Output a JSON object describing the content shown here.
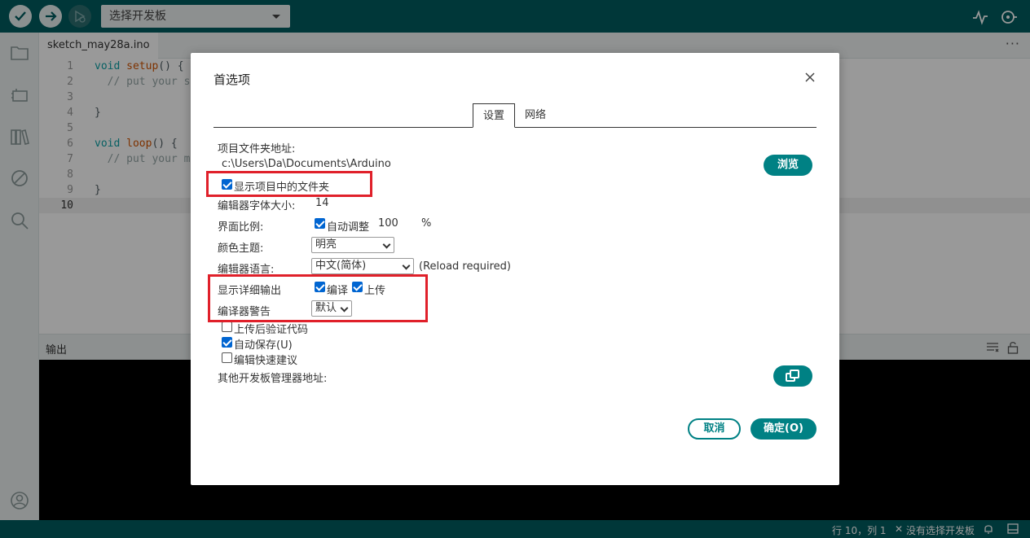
{
  "toolbar": {
    "board_select": "选择开发板",
    "verify_icon": "check-icon",
    "upload_icon": "arrow-right-icon",
    "debug_icon": "debug-icon",
    "serial_plotter_icon": "pulse-icon",
    "serial_monitor_icon": "magnifier-dot-icon"
  },
  "sidebar": {
    "items": [
      "folder-icon",
      "board-icon",
      "library-icon",
      "debug-disabled-icon",
      "search-icon"
    ],
    "account_icon": "user-icon"
  },
  "tabbar": {
    "active_tab": "sketch_may28a.ino",
    "more": "···"
  },
  "editor": {
    "lines": [
      {
        "n": "1",
        "kw": "void",
        "fn": "setup",
        "rest": "() {",
        "comment": ""
      },
      {
        "n": "2",
        "kw": "",
        "fn": "",
        "rest": "  ",
        "comment": "// put your se"
      },
      {
        "n": "3",
        "kw": "",
        "fn": "",
        "rest": "",
        "comment": ""
      },
      {
        "n": "4",
        "kw": "",
        "fn": "",
        "rest": "}",
        "comment": ""
      },
      {
        "n": "5",
        "kw": "",
        "fn": "",
        "rest": "",
        "comment": ""
      },
      {
        "n": "6",
        "kw": "void",
        "fn": "loop",
        "rest": "() {",
        "comment": ""
      },
      {
        "n": "7",
        "kw": "",
        "fn": "",
        "rest": "  ",
        "comment": "// put your ma"
      },
      {
        "n": "8",
        "kw": "",
        "fn": "",
        "rest": "",
        "comment": ""
      },
      {
        "n": "9",
        "kw": "",
        "fn": "",
        "rest": "}",
        "comment": ""
      },
      {
        "n": "10",
        "kw": "",
        "fn": "",
        "rest": "",
        "comment": ""
      }
    ]
  },
  "output": {
    "title": "输出"
  },
  "status": {
    "position": "行 10，列 1",
    "board": "没有选择开发板"
  },
  "dialog": {
    "title": "首选项",
    "tabs": [
      "设置",
      "网络"
    ],
    "sketchbook_label": "项目文件夹地址:",
    "sketchbook_value": "c:\\Users\\Da\\Documents\\Arduino",
    "browse": "浏览",
    "show_files": "显示项目中的文件夹",
    "font_size_label": "编辑器字体大小:",
    "font_size_value": "14",
    "scale_label": "界面比例:",
    "auto_scale": "自动调整",
    "scale_value": "100",
    "scale_unit": "%",
    "theme_label": "颜色主题:",
    "theme_value": "明亮",
    "language_label": "编辑器语言:",
    "language_value": "中文(简体)",
    "reload_note": "(Reload required)",
    "verbose_label": "显示详细输出",
    "verbose_compile": "编译",
    "verbose_upload": "上传",
    "warnings_label": "编译器警告",
    "warnings_value": "默认",
    "verify_after_upload": "上传后验证代码",
    "auto_save": "自动保存(U)",
    "quick_suggestions": "编辑快速建议",
    "board_urls_label": "其他开发板管理器地址:",
    "board_urls_value": "",
    "cancel": "取消",
    "ok": "确定(O)"
  },
  "colors": {
    "teal_dark": "#005c5f",
    "teal_button": "#008184",
    "checkbox_blue": "#0065d1",
    "annotation_red": "#e0202a"
  }
}
